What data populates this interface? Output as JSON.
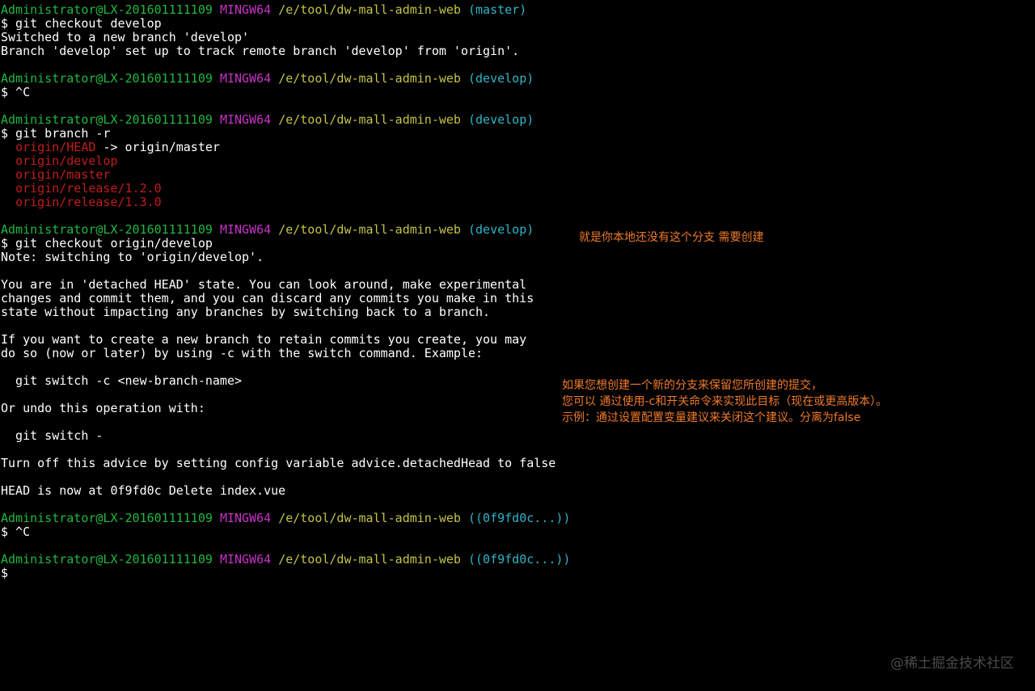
{
  "terminal": {
    "lines": [
      {
        "kind": "prompt",
        "user": "Administrator@LX-201601111109",
        "sys": "MINGW64",
        "path": "/e/tool/dw-mall-admin-web",
        "branch": "(master)"
      },
      {
        "kind": "text",
        "text": "$ git checkout develop"
      },
      {
        "kind": "text",
        "text": "Switched to a new branch 'develop'"
      },
      {
        "kind": "text",
        "text": "Branch 'develop' set up to track remote branch 'develop' from 'origin'."
      },
      {
        "kind": "blank"
      },
      {
        "kind": "prompt",
        "user": "Administrator@LX-201601111109",
        "sys": "MINGW64",
        "path": "/e/tool/dw-mall-admin-web",
        "branch": "(develop)"
      },
      {
        "kind": "text",
        "text": "$ ^C"
      },
      {
        "kind": "blank"
      },
      {
        "kind": "prompt",
        "user": "Administrator@LX-201601111109",
        "sys": "MINGW64",
        "path": "/e/tool/dw-mall-admin-web",
        "branch": "(develop)"
      },
      {
        "kind": "text",
        "text": "$ git branch -r"
      },
      {
        "kind": "remote_head",
        "ref": "origin/HEAD",
        "arrow": " -> origin/master"
      },
      {
        "kind": "remote",
        "ref": "origin/develop"
      },
      {
        "kind": "remote",
        "ref": "origin/master"
      },
      {
        "kind": "remote",
        "ref": "origin/release/1.2.0"
      },
      {
        "kind": "remote",
        "ref": "origin/release/1.3.0"
      },
      {
        "kind": "blank"
      },
      {
        "kind": "prompt",
        "user": "Administrator@LX-201601111109",
        "sys": "MINGW64",
        "path": "/e/tool/dw-mall-admin-web",
        "branch": "(develop)"
      },
      {
        "kind": "text",
        "text": "$ git checkout origin/develop"
      },
      {
        "kind": "text",
        "text": "Note: switching to 'origin/develop'."
      },
      {
        "kind": "blank"
      },
      {
        "kind": "text",
        "text": "You are in 'detached HEAD' state. You can look around, make experimental"
      },
      {
        "kind": "text",
        "text": "changes and commit them, and you can discard any commits you make in this"
      },
      {
        "kind": "text",
        "text": "state without impacting any branches by switching back to a branch."
      },
      {
        "kind": "blank"
      },
      {
        "kind": "text",
        "text": "If you want to create a new branch to retain commits you create, you may"
      },
      {
        "kind": "text",
        "text": "do so (now or later) by using -c with the switch command. Example:"
      },
      {
        "kind": "blank"
      },
      {
        "kind": "text",
        "text": "  git switch -c <new-branch-name>"
      },
      {
        "kind": "blank"
      },
      {
        "kind": "text",
        "text": "Or undo this operation with:"
      },
      {
        "kind": "blank"
      },
      {
        "kind": "text",
        "text": "  git switch -"
      },
      {
        "kind": "blank"
      },
      {
        "kind": "text",
        "text": "Turn off this advice by setting config variable advice.detachedHead to false"
      },
      {
        "kind": "blank"
      },
      {
        "kind": "text",
        "text": "HEAD is now at 0f9fd0c Delete index.vue"
      },
      {
        "kind": "blank"
      },
      {
        "kind": "prompt",
        "user": "Administrator@LX-201601111109",
        "sys": "MINGW64",
        "path": "/e/tool/dw-mall-admin-web",
        "branch": "((0f9fd0c...))"
      },
      {
        "kind": "text",
        "text": "$ ^C"
      },
      {
        "kind": "blank"
      },
      {
        "kind": "prompt",
        "user": "Administrator@LX-201601111109",
        "sys": "MINGW64",
        "path": "/e/tool/dw-mall-admin-web",
        "branch": "((0f9fd0c...))"
      },
      {
        "kind": "text",
        "text": "$"
      }
    ]
  },
  "annotations": {
    "note1": "就是你本地还没有这个分支 需要创建",
    "note2": "如果您想创建一个新的分支来保留您所创建的提交，\n您可以 通过使用-c和开关命令来实现此目标（现在或更高版本）。\n示例：通过设置配置变量建议来关闭这个建议。分离为false"
  },
  "watermark": "@稀土掘金技术社区",
  "colors": {
    "background": "#000000",
    "user": "#1fb83f",
    "system": "#c832c8",
    "path": "#c3c346",
    "branch": "#2fb4c8",
    "remote_branch": "#c11c1c",
    "text": "#ffffff",
    "annotation": "#f07a2a",
    "watermark": "#4a4a4a"
  }
}
